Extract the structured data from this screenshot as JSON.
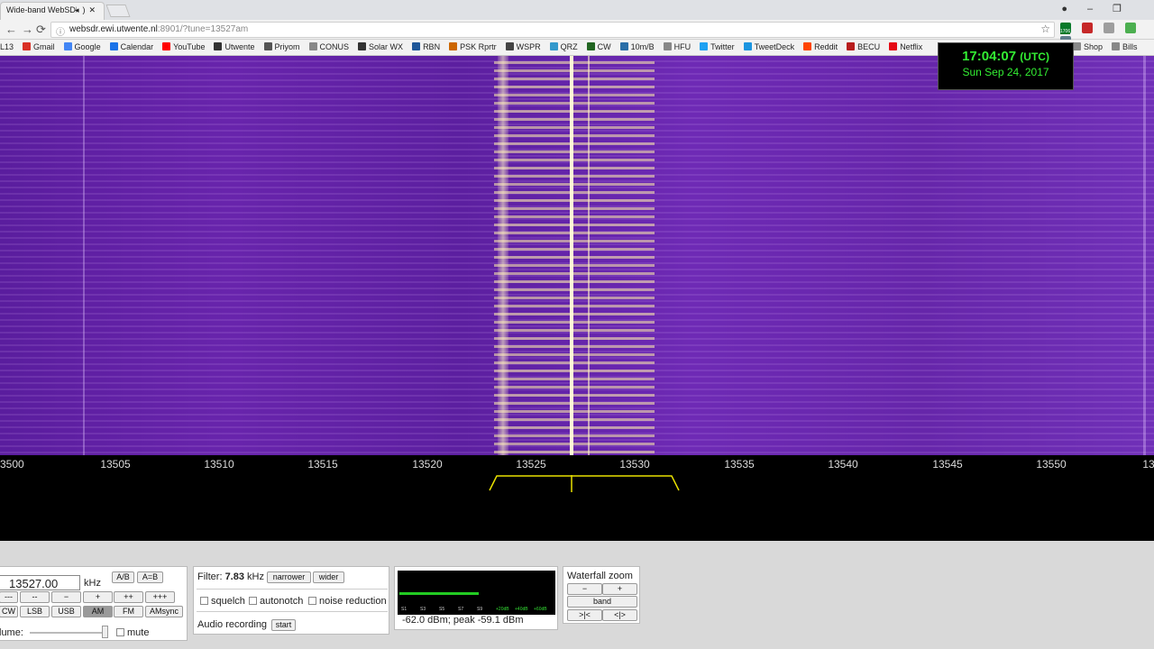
{
  "browser": {
    "tab_title": "Wide-band WebSDR",
    "url_host": "websdr.ewi.utwente.nl",
    "url_rest": ":8901/?tune=13527am",
    "ext_badge": "1706",
    "bookmarks": [
      {
        "label": "L13",
        "color": "#555555"
      },
      {
        "label": "Gmail",
        "color": "#d93025"
      },
      {
        "label": "Google",
        "color": "#4285f4"
      },
      {
        "label": "Calendar",
        "color": "#1a73e8"
      },
      {
        "label": "YouTube",
        "color": "#ff0000"
      },
      {
        "label": "Utwente",
        "color": "#333333"
      },
      {
        "label": "Priyom",
        "color": "#555555"
      },
      {
        "label": "CONUS",
        "color": "#888888"
      },
      {
        "label": "Solar WX",
        "color": "#333333"
      },
      {
        "label": "RBN",
        "color": "#1e5799"
      },
      {
        "label": "PSK Rprtr",
        "color": "#cc6600"
      },
      {
        "label": "WSPR",
        "color": "#444444"
      },
      {
        "label": "QRZ",
        "color": "#3399cc"
      },
      {
        "label": "CW",
        "color": "#226622"
      },
      {
        "label": "10m/B",
        "color": "#2a6fa8"
      },
      {
        "label": "HFU",
        "color": "#888888"
      },
      {
        "label": "Twitter",
        "color": "#1da1f2"
      },
      {
        "label": "TweetDeck",
        "color": "#1b95e0"
      },
      {
        "label": "Reddit",
        "color": "#ff4500"
      },
      {
        "label": "BECU",
        "color": "#b71c1c"
      },
      {
        "label": "Netflix",
        "color": "#e50914"
      }
    ],
    "bookmarks_right": [
      {
        "label": "Shop",
        "color": "#888888"
      },
      {
        "label": "Bills",
        "color": "#888888"
      }
    ]
  },
  "clock": {
    "time": "17:04:07",
    "tz": "(UTC)",
    "date": "Sun Sep 24, 2017"
  },
  "scale": {
    "ticks": [
      "3500",
      "13505",
      "13510",
      "13515",
      "13520",
      "13525",
      "13530",
      "13535",
      "13540",
      "13545",
      "13550",
      "13"
    ]
  },
  "tuning": {
    "frequency": "13527.00",
    "unit": "kHz",
    "ab": "A/B",
    "aeqb": "A=B",
    "step_buttons": [
      "---",
      "--",
      "−",
      "+",
      "++",
      "+++"
    ],
    "modes": [
      "CW",
      "LSB",
      "USB",
      "AM",
      "FM",
      "AMsync"
    ],
    "active_mode": "AM",
    "volume_label": "lume:",
    "mute_label": "mute"
  },
  "filter": {
    "label": "Filter:",
    "value": "7.83",
    "unit": "kHz",
    "narrower": "narrower",
    "wider": "wider",
    "squelch": "squelch",
    "autonotch": "autonotch",
    "noise_reduction": "noise reduction",
    "recording_label": "Audio recording",
    "start": "start"
  },
  "smeter": {
    "scale_labels": [
      "S1",
      "S3",
      "S5",
      "S7",
      "S9",
      "+20dB",
      "+40dB",
      "+60dB"
    ],
    "level_fraction": 0.55,
    "readout": "-62.0 dBm; peak  -59.1 dBm"
  },
  "zoom": {
    "title": "Waterfall zoom",
    "minus": "−",
    "plus": "+",
    "band": "band",
    "left": ">|<",
    "right": "<|>"
  },
  "colors": {
    "waterfall_base": "#5f22a3",
    "signal_hot": "#fff6b0",
    "clock_text": "#33ee33",
    "passband": "#e8e000",
    "smeter_bar": "#22cc22"
  }
}
